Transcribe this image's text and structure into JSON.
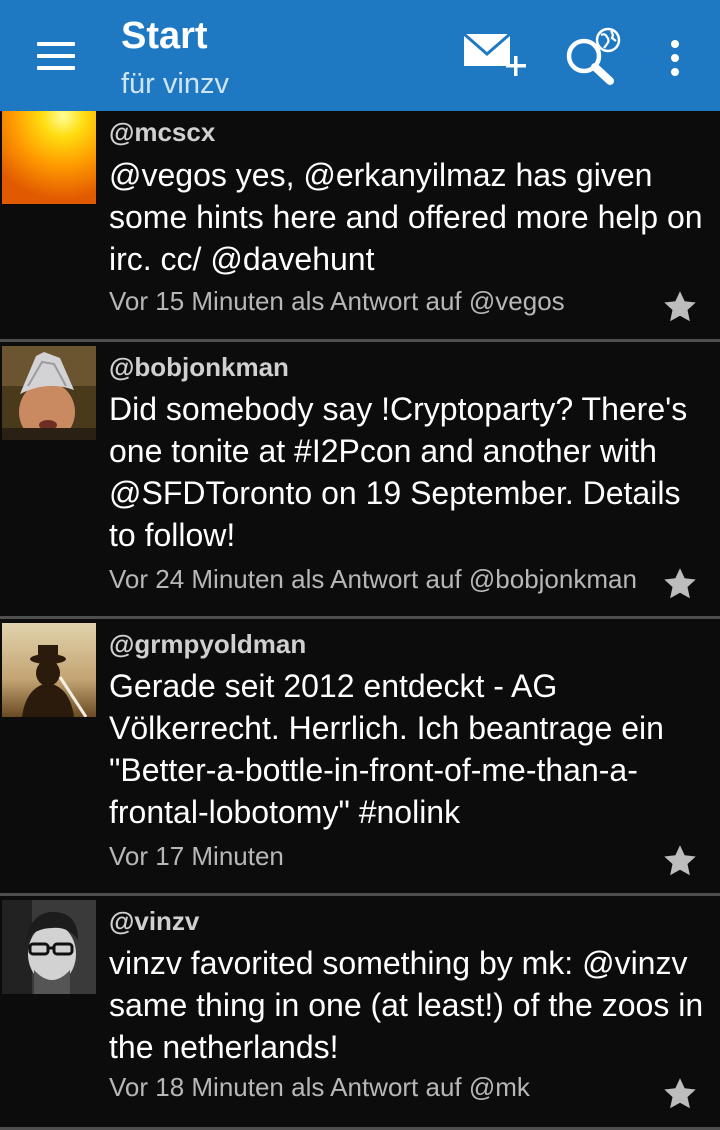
{
  "header": {
    "title": "Start",
    "subtitle": "für vinzv",
    "menu_icon": "hamburger-menu-icon",
    "actions": [
      "compose-message-icon",
      "search-world-icon",
      "overflow-menu-icon"
    ],
    "color": "#1e79c2"
  },
  "tweets": [
    {
      "user": "@mcscx",
      "text": "@vegos yes, @erkanyilmaz has given some hints here and offered more help on irc. cc/ @davehunt",
      "meta": "Vor 15 Minuten als Antwort auf @vegos"
    },
    {
      "user": "@bobjonkman",
      "text": "Did somebody say !Cryptoparty? There's one tonite at #I2Pcon and another with @SFDToronto on 19 September. Details to follow!",
      "meta": "Vor 24 Minuten als Antwort auf @bobjonkman"
    },
    {
      "user": "@grmpyoldman",
      "text": "Gerade seit 2012 entdeckt - AG Völkerrecht. Herrlich. Ich beantrage ein \"Better-a-bottle-in-front-of-me-than-a-frontal-lobotomy\" #nolink",
      "meta": "Vor 17 Minuten"
    },
    {
      "user": "@vinzv",
      "text": "vinzv favorited something by mk: @vinzv same thing in one (at least!) of the zoos in the netherlands!",
      "meta": "Vor 18 Minuten als Antwort auf @mk"
    }
  ]
}
